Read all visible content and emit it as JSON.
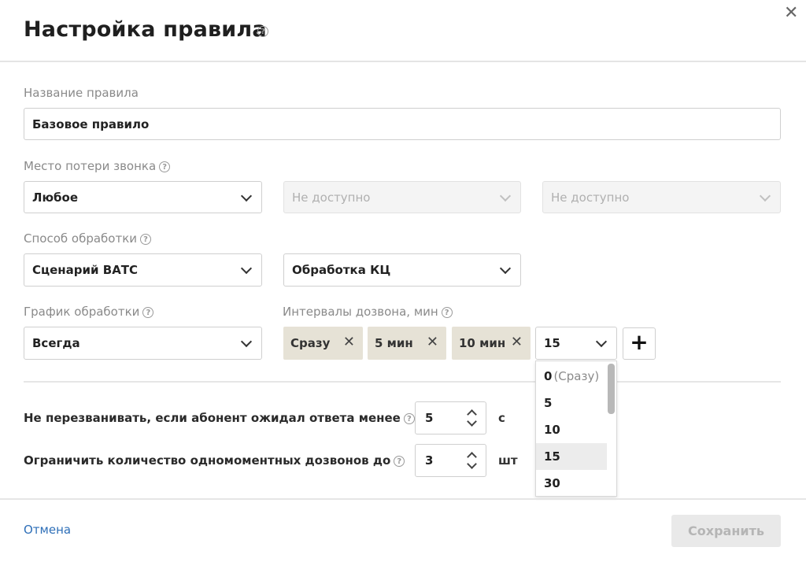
{
  "dialog": {
    "title": "Настройка правила",
    "close_icon": "close-icon"
  },
  "rule_name": {
    "label": "Название правила",
    "value": "Базовое правило"
  },
  "call_loss_place": {
    "label": "Место потери звонка",
    "select1": "Любое",
    "select2": "Не доступно",
    "select3": "Не доступно"
  },
  "processing_method": {
    "label": "Способ обработки",
    "select1": "Сценарий ВАТС",
    "select2": "Обработка КЦ"
  },
  "processing_schedule": {
    "label": "График обработки",
    "value": "Всегда"
  },
  "dial_intervals": {
    "label": "Интервалы дозвона, мин",
    "chips": [
      "Сразу",
      "5 мин",
      "10 мин"
    ],
    "select_value": "15",
    "options": [
      {
        "value": "0",
        "hint": "(Сразу)"
      },
      {
        "value": "5",
        "hint": ""
      },
      {
        "value": "10",
        "hint": ""
      },
      {
        "value": "15",
        "hint": ""
      },
      {
        "value": "30",
        "hint": ""
      }
    ],
    "highlighted_option": "15"
  },
  "no_callback": {
    "label": "Не перезванивать, если абонент ожидал ответа менее",
    "value": "5",
    "unit": "с"
  },
  "limit_calls": {
    "label": "Ограничить количество одномоментных дозвонов до",
    "value": "3",
    "unit": "шт"
  },
  "footer": {
    "cancel": "Отмена",
    "save": "Сохранить"
  },
  "colors": {
    "chip_bg": "#e6e2d6",
    "link": "#2e6fb8",
    "disabled_button": "#e9e9e9"
  }
}
